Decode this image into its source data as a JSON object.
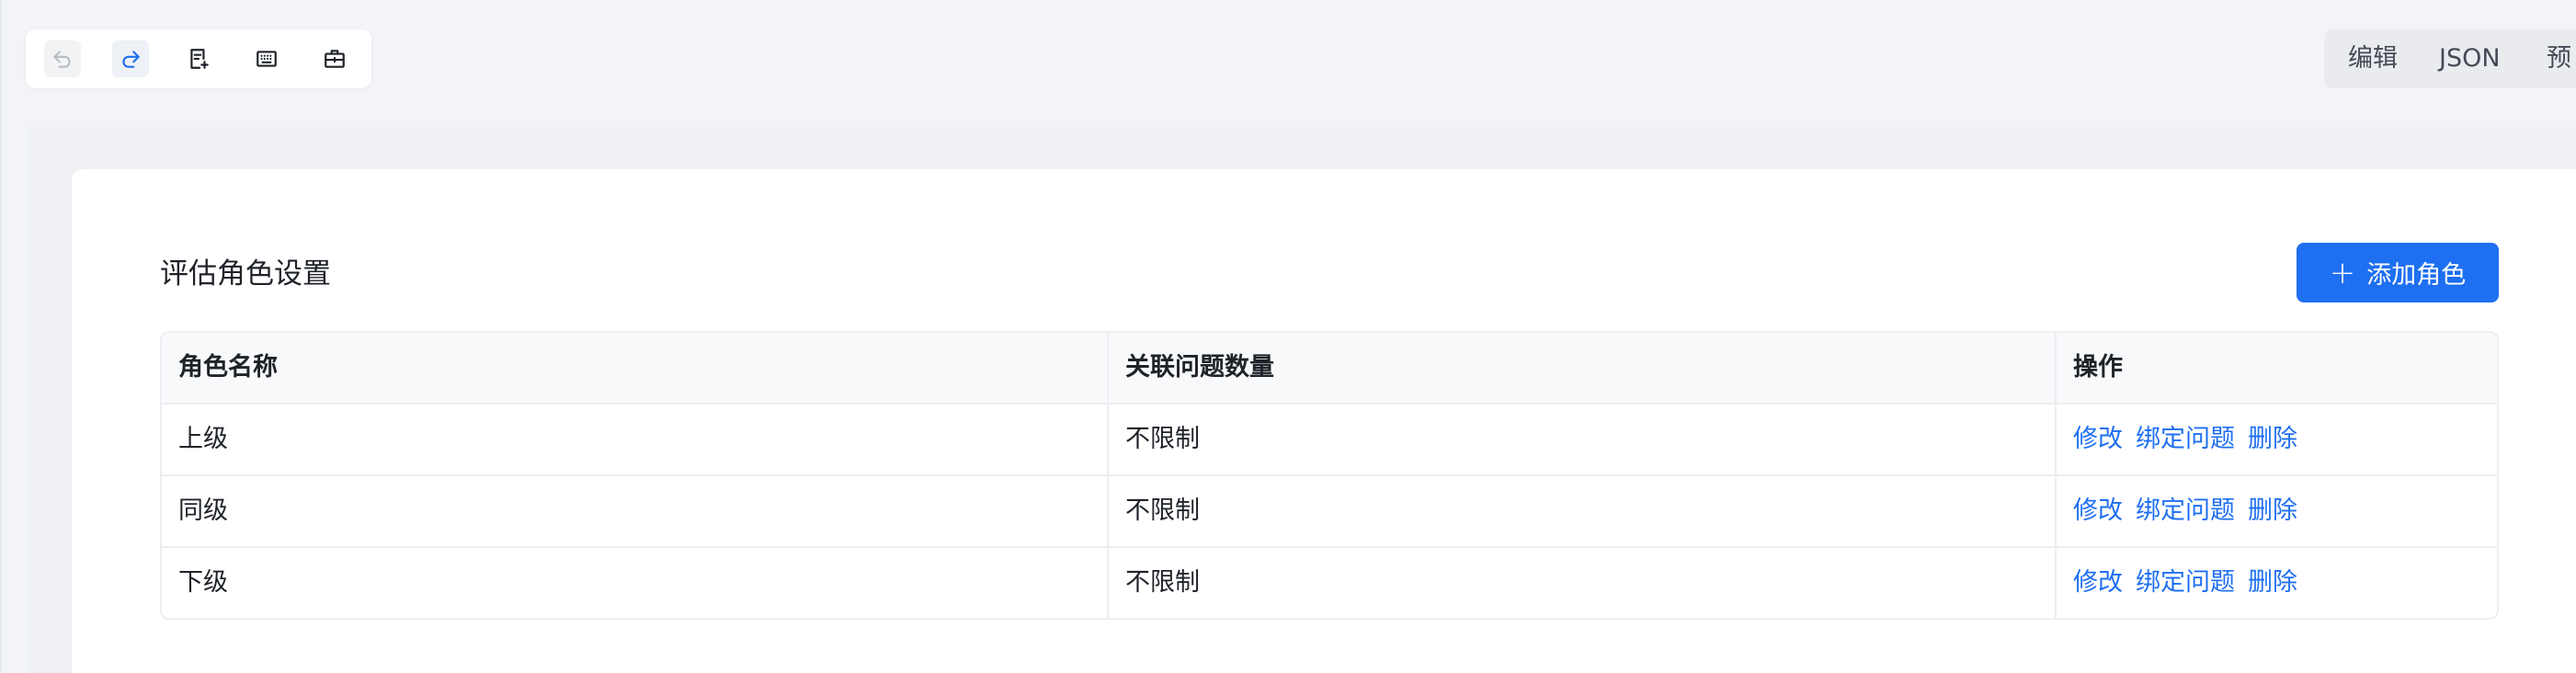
{
  "toolbar": {
    "icons": [
      "undo-icon",
      "redo-icon",
      "page-add-icon",
      "keyboard-icon",
      "toolbox-icon"
    ]
  },
  "modes": {
    "edit": "编辑",
    "json": "JSON",
    "preview": "预"
  },
  "section": {
    "title": "评估角色设置",
    "add_button": "添加角色",
    "add_icon": "+"
  },
  "table": {
    "headers": [
      "角色名称",
      "关联问题数量",
      "操作"
    ],
    "rows": [
      {
        "role": "上级",
        "count": "不限制"
      },
      {
        "role": "同级",
        "count": "不限制"
      },
      {
        "role": "下级",
        "count": "不限制"
      }
    ],
    "actions": {
      "edit": "修改",
      "bind": "绑定问题",
      "delete": "删除"
    }
  },
  "colors": {
    "accent": "#1e6ff1",
    "background": "#f3f4f7",
    "card": "#ffffff",
    "border": "#eceef2"
  }
}
